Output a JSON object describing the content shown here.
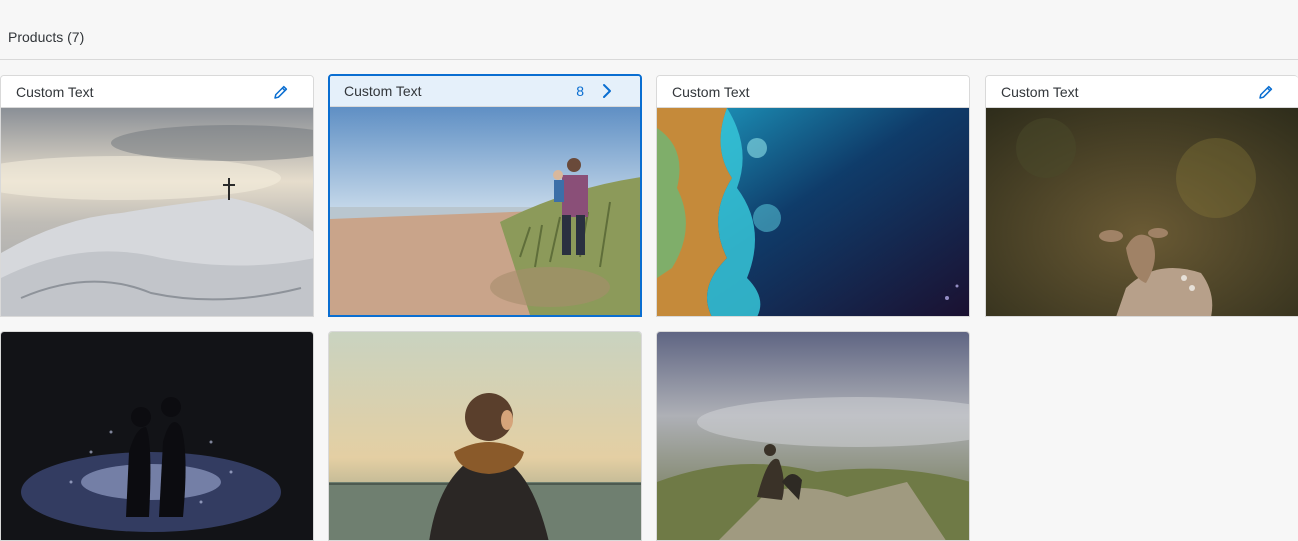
{
  "toolbar": {
    "title": "Products (7)"
  },
  "cards": [
    {
      "title": "Custom Text",
      "count": "",
      "action_icon": "edit-icon",
      "image": "snowy-mountain-cross"
    },
    {
      "title": "Custom Text",
      "count": "8",
      "action_icon": "chevron-right-icon",
      "image": "beach-father-child",
      "selected": true
    },
    {
      "title": "Custom Text",
      "count": "",
      "action_icon": "",
      "image": "satellite-coastline"
    },
    {
      "title": "Custom Text",
      "count": "",
      "action_icon": "edit-icon",
      "image": "deer-forest"
    },
    {
      "title": "",
      "count": "",
      "action_icon": "",
      "image": "couple-rain-night"
    },
    {
      "title": "",
      "count": "",
      "action_icon": "",
      "image": "person-scarf-sea"
    },
    {
      "title": "",
      "count": "",
      "action_icon": "",
      "image": "person-cliff-mist"
    }
  ],
  "colors": {
    "accent": "#0a6ed1",
    "selected_bg": "#e5f0fa",
    "page_bg": "#f7f7f7",
    "border": "#d9d9d9"
  }
}
